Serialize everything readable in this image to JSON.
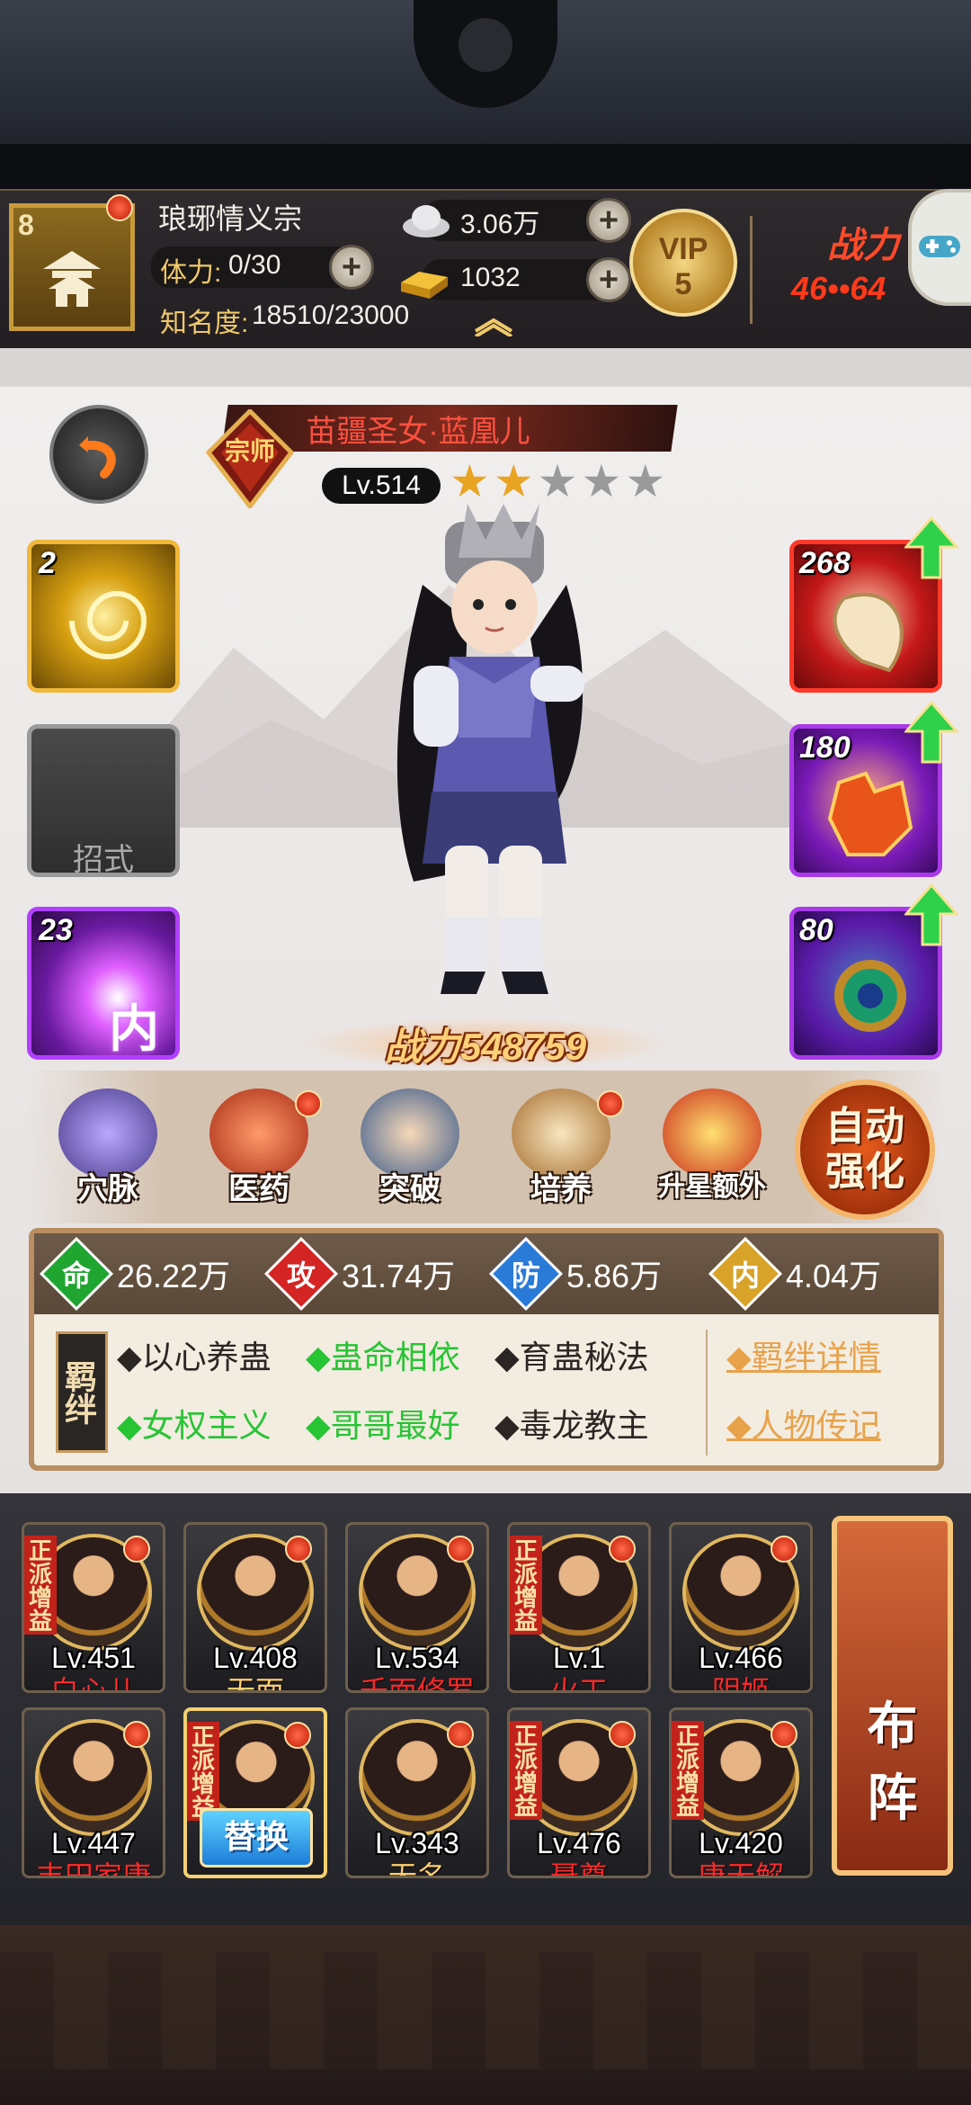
{
  "topbar": {
    "sect_level": "8",
    "guild_name": "琅琊情义宗",
    "stamina_label": "体力:",
    "stamina_value": "0/30",
    "fame_label": "知名度:",
    "fame_value": "18510/23000",
    "silver": "3.06万",
    "gold": "1032",
    "vip_label": "VIP",
    "vip_level": "5",
    "power_label": "战力",
    "power_value": "46••64"
  },
  "hero": {
    "rank_char": "宗师",
    "name": "苗疆圣女·蓝凰儿",
    "level": "Lv.514",
    "stars_filled": 2,
    "stars_total": 5,
    "battle_power_label": "战力",
    "battle_power": "548759"
  },
  "left_slots": [
    {
      "count": "2",
      "label": "",
      "kind": "martial"
    },
    {
      "count": "",
      "label": "招式",
      "kind": "empty"
    },
    {
      "count": "23",
      "label": "内",
      "kind": "inner"
    }
  ],
  "right_slots": [
    {
      "count": "268",
      "kind": "weapon"
    },
    {
      "count": "180",
      "kind": "armor"
    },
    {
      "count": "80",
      "kind": "accessory"
    }
  ],
  "functions": [
    {
      "label": "穴脉",
      "dot": false
    },
    {
      "label": "医药",
      "dot": true
    },
    {
      "label": "突破",
      "dot": false
    },
    {
      "label": "培养",
      "dot": true
    },
    {
      "label": "升星额外",
      "dot": false
    }
  ],
  "auto_button": {
    "line1": "自动",
    "line2": "强化"
  },
  "stats": [
    {
      "icon": "命",
      "value": "26.22万",
      "color": "#1fa530"
    },
    {
      "icon": "攻",
      "value": "31.74万",
      "color": "#d42424"
    },
    {
      "icon": "防",
      "value": "5.86万",
      "color": "#2a7ad8"
    },
    {
      "icon": "内",
      "value": "4.04万",
      "color": "#d9a32a"
    }
  ],
  "bond_tag": "羁绊",
  "bonds": [
    {
      "text": "◆以心养蛊",
      "active": false
    },
    {
      "text": "◆蛊命相依",
      "active": true
    },
    {
      "text": "◆育蛊秘法",
      "active": false
    },
    {
      "text": "◆女权主义",
      "active": true
    },
    {
      "text": "◆哥哥最好",
      "active": true
    },
    {
      "text": "◆毒龙教主",
      "active": false
    }
  ],
  "bond_links": [
    "◆羁绊详情",
    "◆人物传记"
  ],
  "roster": [
    {
      "level": "Lv.451",
      "name": "白心儿",
      "zp": true
    },
    {
      "level": "Lv.408",
      "name": "无面",
      "zp": false,
      "gold": true
    },
    {
      "level": "Lv.534",
      "name": "千面修罗",
      "zp": false
    },
    {
      "level": "Lv.1",
      "name": "火工",
      "zp": true
    },
    {
      "level": "Lv.466",
      "name": "阴姬",
      "zp": false
    },
    {
      "level": "Lv.447",
      "name": "丰田家康",
      "zp": false
    },
    {
      "level": "",
      "name": "",
      "zp": true,
      "selected": true
    },
    {
      "level": "Lv.343",
      "name": "无名",
      "zp": false,
      "gold": true
    },
    {
      "level": "Lv.476",
      "name": "聂尊",
      "zp": true
    },
    {
      "level": "Lv.420",
      "name": "唐无解",
      "zp": true
    }
  ],
  "zp_tag": "正派增益",
  "swap_label": "替换",
  "formation": {
    "line1": "布",
    "line2": "阵"
  },
  "colors": {
    "accent_gold": "#f0c96a",
    "bond_active": "#27c434",
    "name_red": "#ff2a2a"
  }
}
